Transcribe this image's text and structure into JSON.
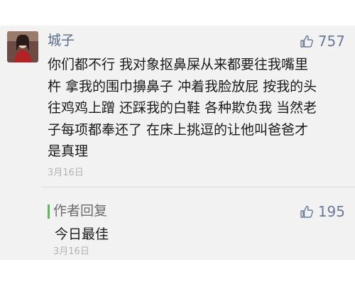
{
  "comment": {
    "username": "城子",
    "like_count": "757",
    "lines": [
      "你们都不行 我对象抠鼻屎从来都要往我嘴里",
      "杵 拿我的围巾擤鼻子 冲着我脸放屁 按我的头",
      "往鸡鸡上蹭 还踩我的白鞋 各种欺负我 当然老",
      "子每项都奉还了 在床上挑逗的让他叫爸爸才",
      "是真理"
    ],
    "date": "3月16日"
  },
  "reply": {
    "label": "作者回复",
    "like_count": "195",
    "text": "今日最佳",
    "date": "3月16日"
  },
  "colors": {
    "username": "#5a6c8c",
    "reply_bar": "#5cb85c",
    "panel_bg": "#f2f2f2"
  }
}
